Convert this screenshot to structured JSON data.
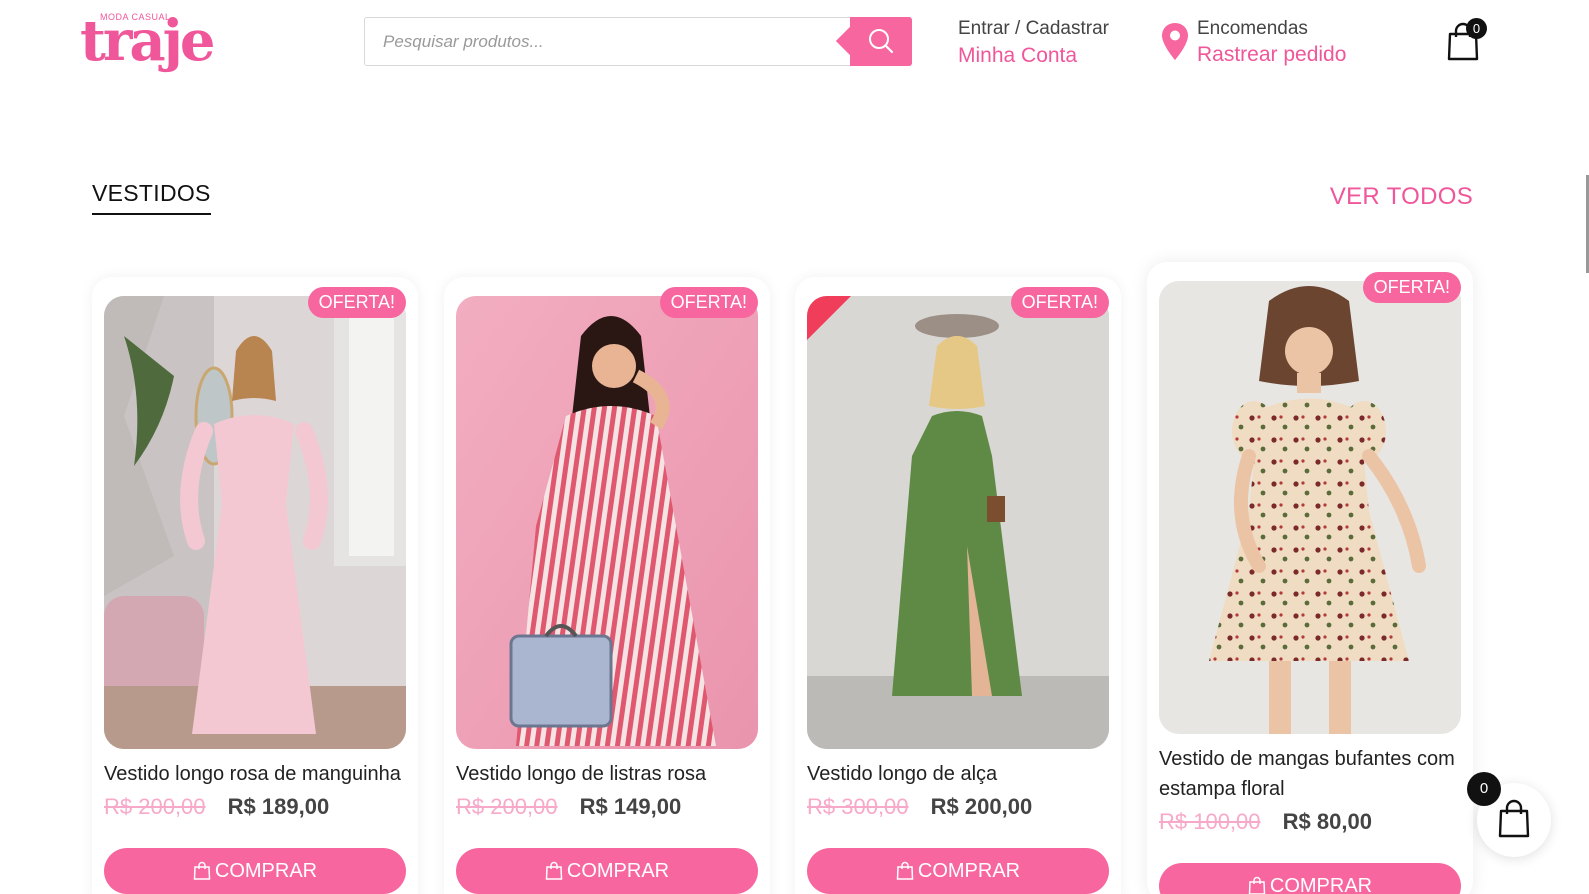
{
  "brand": {
    "tagline": "MODA CASUAL",
    "name": "traje"
  },
  "search": {
    "placeholder": "Pesquisar produtos..."
  },
  "account": {
    "line1": "Entrar / Cadastrar",
    "line2": "Minha Conta"
  },
  "orders": {
    "line1": "Encomendas",
    "line2": "Rastrear pedido"
  },
  "cart": {
    "count": "0"
  },
  "section": {
    "title": "VESTIDOS",
    "see_all": "VER TODOS"
  },
  "products": [
    {
      "badge": "OFERTA!",
      "name": "Vestido longo rosa de manguinha",
      "old_price": "R$ 200,00",
      "price": "R$ 189,00",
      "button": "COMPRAR"
    },
    {
      "badge": "OFERTA!",
      "name": "Vestido longo de listras rosa",
      "old_price": "R$ 200,00",
      "price": "R$ 149,00",
      "button": "COMPRAR"
    },
    {
      "badge": "OFERTA!",
      "name": "Vestido longo de alça",
      "old_price": "R$ 300,00",
      "price": "R$ 200,00",
      "button": "COMPRAR"
    },
    {
      "badge": "OFERTA!",
      "name": "Vestido de mangas bufantes com estampa floral",
      "old_price": "R$ 100,00",
      "price": "R$ 80,00",
      "button": "COMPRAR"
    }
  ],
  "floating_cart": {
    "count": "0"
  },
  "colors": {
    "accent": "#f7669e",
    "text": "#333333"
  }
}
